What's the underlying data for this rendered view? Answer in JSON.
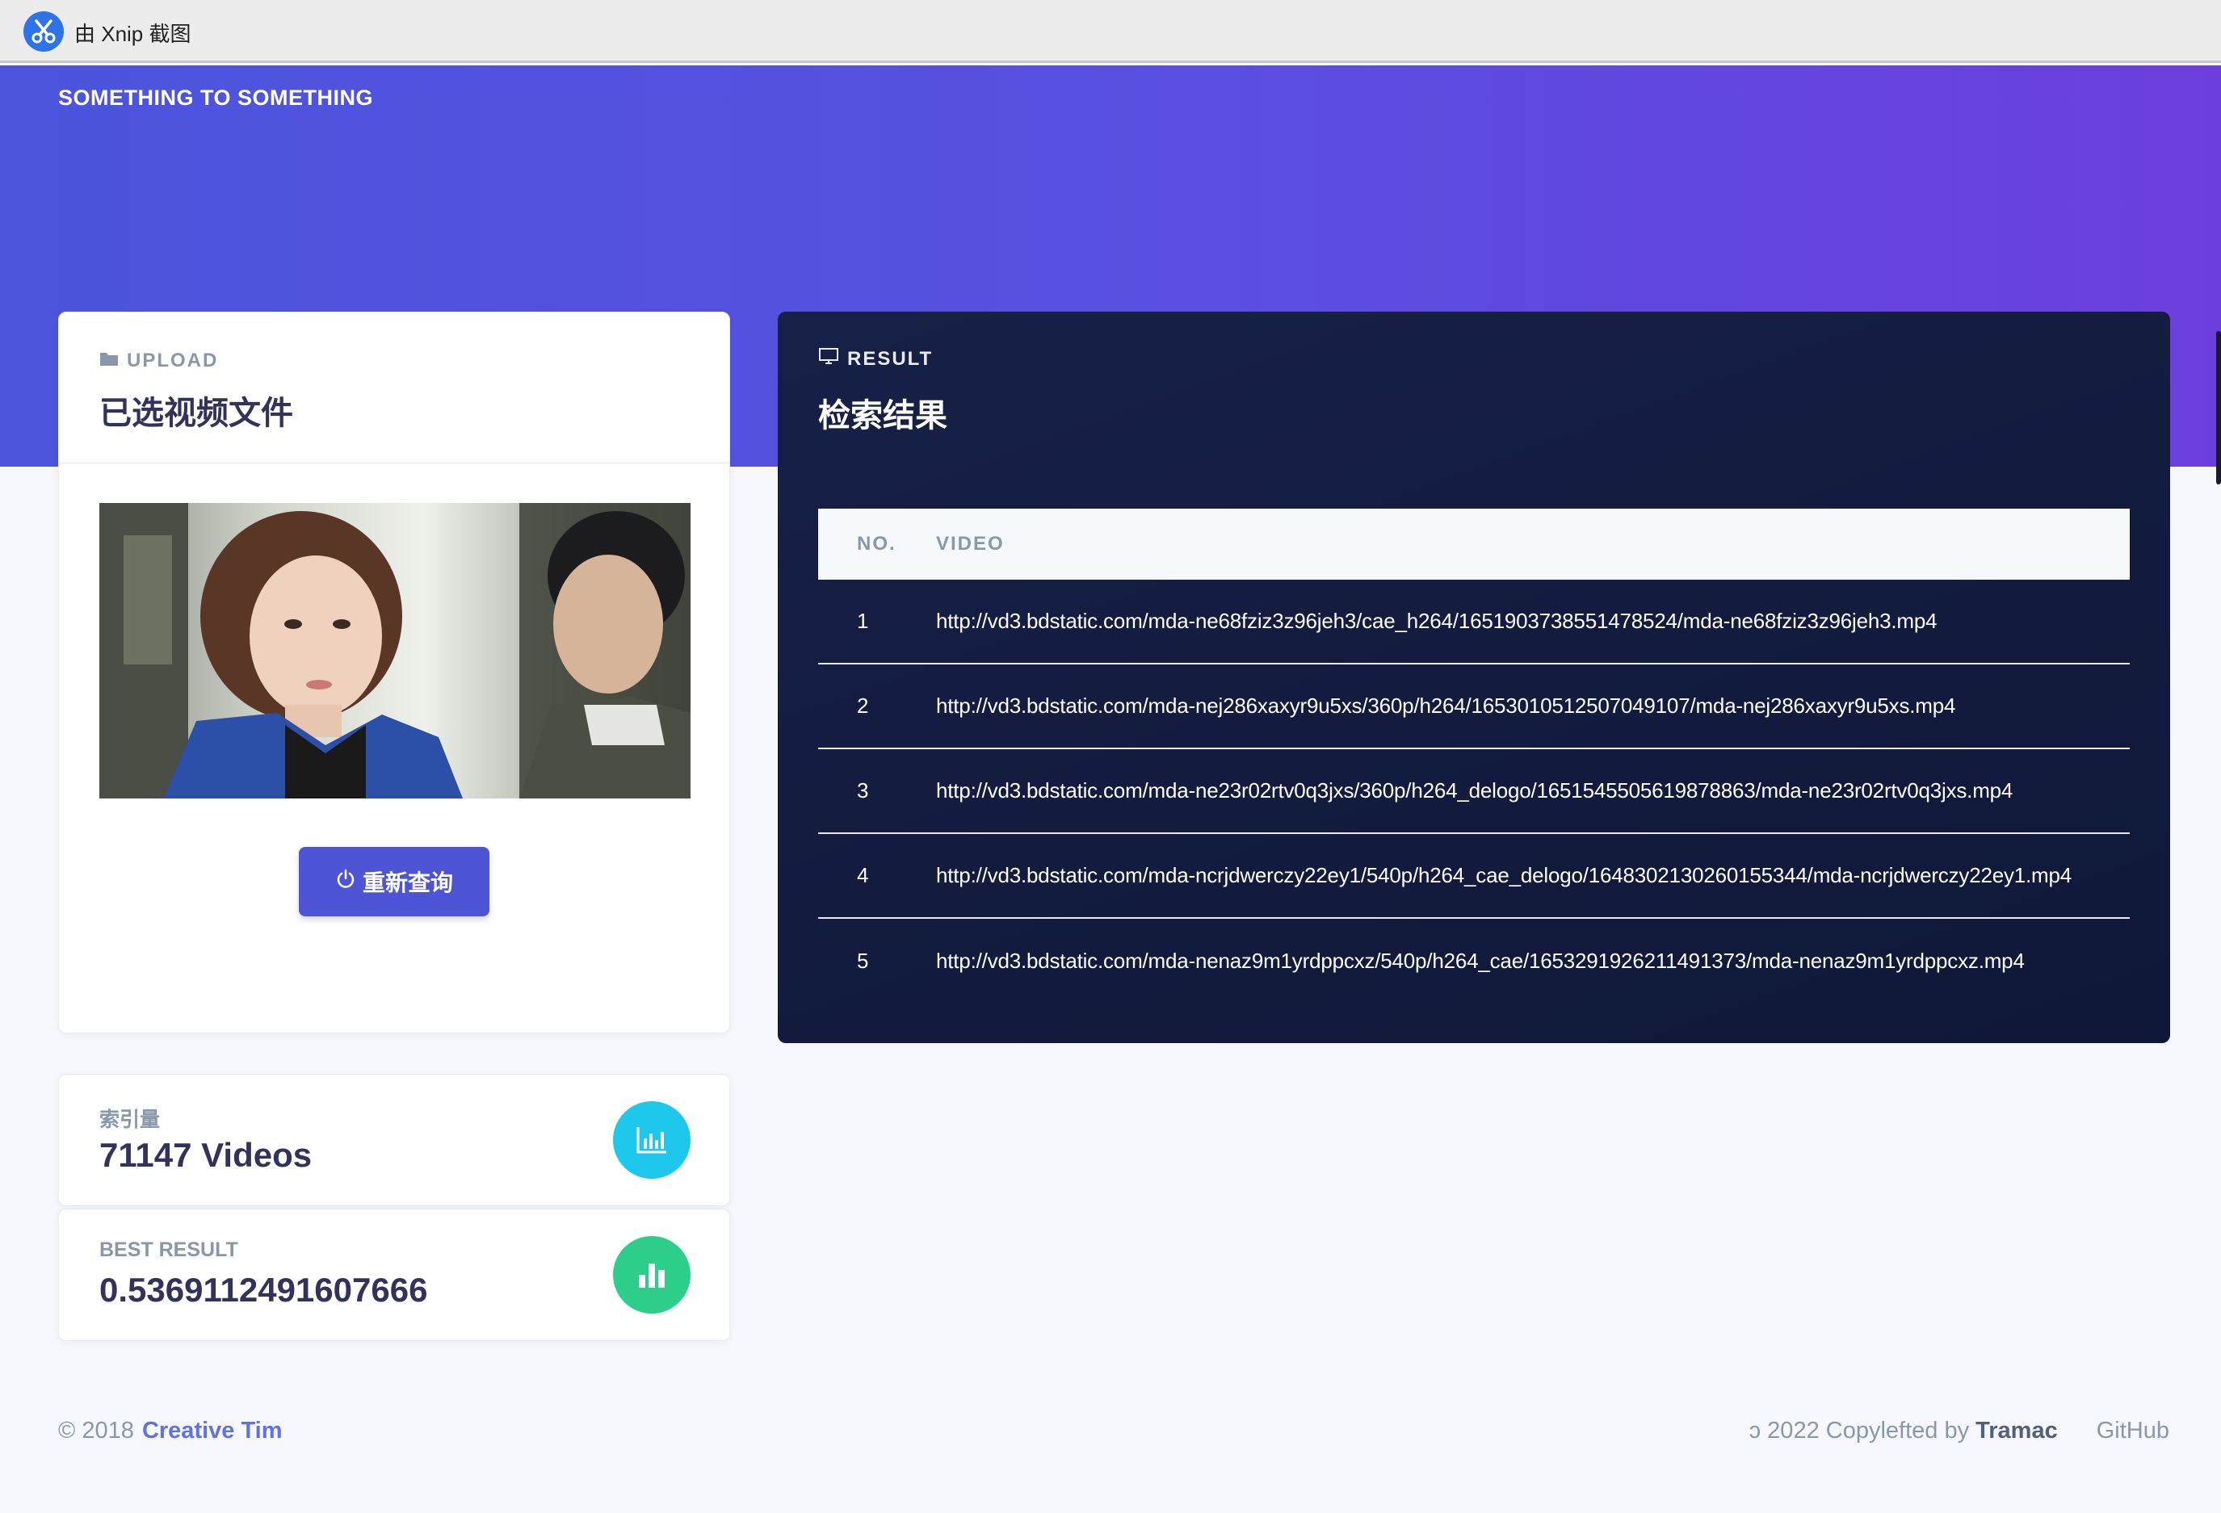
{
  "window": {
    "title": "由 Xnip 截图",
    "logo_icon": "xnip-scissors-icon"
  },
  "brand": "SOMETHING TO SOMETHING",
  "colors": {
    "hero_start": "#4c55dc",
    "hero_end": "#6c3fdc",
    "primary": "#4d55d6",
    "result_bg": "#172046",
    "info": "#1ec8ec",
    "success": "#2dce89"
  },
  "upload": {
    "eyebrow_icon": "folder-icon",
    "eyebrow": "UPLOAD",
    "title": "已选视频文件",
    "requery_icon": "power-icon",
    "requery_label": "重新查询"
  },
  "result": {
    "eyebrow_icon": "monitor-icon",
    "eyebrow": "RESULT",
    "title": "检索结果",
    "columns": [
      "NO.",
      "VIDEO"
    ],
    "rows": [
      {
        "no": "1",
        "video": "http://vd3.bdstatic.com/mda-ne68fziz3z96jeh3/cae_h264/1651903738551478524/mda-ne68fziz3z96jeh3.mp4"
      },
      {
        "no": "2",
        "video": "http://vd3.bdstatic.com/mda-nej286xaxyr9u5xs/360p/h264/1653010512507049107/mda-nej286xaxyr9u5xs.mp4"
      },
      {
        "no": "3",
        "video": "http://vd3.bdstatic.com/mda-ne23r02rtv0q3jxs/360p/h264_delogo/1651545505619878863/mda-ne23r02rtv0q3jxs.mp4"
      },
      {
        "no": "4",
        "video": "http://vd3.bdstatic.com/mda-ncrjdwerczy22ey1/540p/h264_cae_delogo/1648302130260155344/mda-ncrjdwerczy22ey1.mp4"
      },
      {
        "no": "5",
        "video": "http://vd3.bdstatic.com/mda-nenaz9m1yrdppcxz/540p/h264_cae/1653291926211491373/mda-nenaz9m1yrdppcxz.mp4"
      }
    ]
  },
  "stats": {
    "index": {
      "label": "索引量",
      "value": "71147 Videos",
      "icon": "bar-chart-icon"
    },
    "best": {
      "label": "BEST RESULT",
      "value": "0.5369112491607666",
      "icon": "chart-bar-icon"
    }
  },
  "footer": {
    "copyright": "© 2018",
    "creative_tim": "Creative Tim",
    "copyleft_prefix": "ɔ 2022 Copylefted by",
    "copyleft_author": "Tramac",
    "github": "GitHub"
  }
}
